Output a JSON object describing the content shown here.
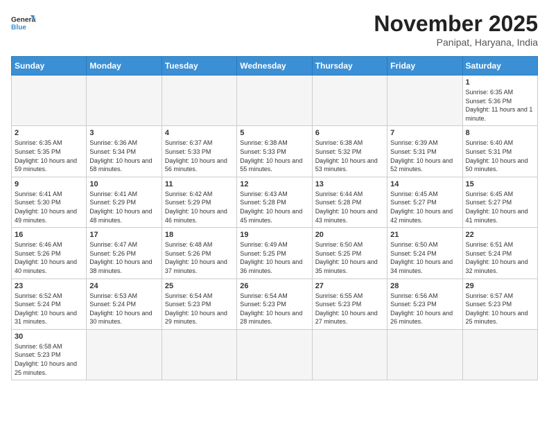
{
  "logo": {
    "line1": "General",
    "line2": "Blue"
  },
  "title": "November 2025",
  "location": "Panipat, Haryana, India",
  "days_of_week": [
    "Sunday",
    "Monday",
    "Tuesday",
    "Wednesday",
    "Thursday",
    "Friday",
    "Saturday"
  ],
  "weeks": [
    [
      {
        "day": null,
        "info": null
      },
      {
        "day": null,
        "info": null
      },
      {
        "day": null,
        "info": null
      },
      {
        "day": null,
        "info": null
      },
      {
        "day": null,
        "info": null
      },
      {
        "day": null,
        "info": null
      },
      {
        "day": "1",
        "info": "Sunrise: 6:35 AM\nSunset: 5:36 PM\nDaylight: 11 hours and 1 minute."
      }
    ],
    [
      {
        "day": "2",
        "info": "Sunrise: 6:35 AM\nSunset: 5:35 PM\nDaylight: 10 hours and 59 minutes."
      },
      {
        "day": "3",
        "info": "Sunrise: 6:36 AM\nSunset: 5:34 PM\nDaylight: 10 hours and 58 minutes."
      },
      {
        "day": "4",
        "info": "Sunrise: 6:37 AM\nSunset: 5:33 PM\nDaylight: 10 hours and 56 minutes."
      },
      {
        "day": "5",
        "info": "Sunrise: 6:38 AM\nSunset: 5:33 PM\nDaylight: 10 hours and 55 minutes."
      },
      {
        "day": "6",
        "info": "Sunrise: 6:38 AM\nSunset: 5:32 PM\nDaylight: 10 hours and 53 minutes."
      },
      {
        "day": "7",
        "info": "Sunrise: 6:39 AM\nSunset: 5:31 PM\nDaylight: 10 hours and 52 minutes."
      },
      {
        "day": "8",
        "info": "Sunrise: 6:40 AM\nSunset: 5:31 PM\nDaylight: 10 hours and 50 minutes."
      }
    ],
    [
      {
        "day": "9",
        "info": "Sunrise: 6:41 AM\nSunset: 5:30 PM\nDaylight: 10 hours and 49 minutes."
      },
      {
        "day": "10",
        "info": "Sunrise: 6:41 AM\nSunset: 5:29 PM\nDaylight: 10 hours and 48 minutes."
      },
      {
        "day": "11",
        "info": "Sunrise: 6:42 AM\nSunset: 5:29 PM\nDaylight: 10 hours and 46 minutes."
      },
      {
        "day": "12",
        "info": "Sunrise: 6:43 AM\nSunset: 5:28 PM\nDaylight: 10 hours and 45 minutes."
      },
      {
        "day": "13",
        "info": "Sunrise: 6:44 AM\nSunset: 5:28 PM\nDaylight: 10 hours and 43 minutes."
      },
      {
        "day": "14",
        "info": "Sunrise: 6:45 AM\nSunset: 5:27 PM\nDaylight: 10 hours and 42 minutes."
      },
      {
        "day": "15",
        "info": "Sunrise: 6:45 AM\nSunset: 5:27 PM\nDaylight: 10 hours and 41 minutes."
      }
    ],
    [
      {
        "day": "16",
        "info": "Sunrise: 6:46 AM\nSunset: 5:26 PM\nDaylight: 10 hours and 40 minutes."
      },
      {
        "day": "17",
        "info": "Sunrise: 6:47 AM\nSunset: 5:26 PM\nDaylight: 10 hours and 38 minutes."
      },
      {
        "day": "18",
        "info": "Sunrise: 6:48 AM\nSunset: 5:26 PM\nDaylight: 10 hours and 37 minutes."
      },
      {
        "day": "19",
        "info": "Sunrise: 6:49 AM\nSunset: 5:25 PM\nDaylight: 10 hours and 36 minutes."
      },
      {
        "day": "20",
        "info": "Sunrise: 6:50 AM\nSunset: 5:25 PM\nDaylight: 10 hours and 35 minutes."
      },
      {
        "day": "21",
        "info": "Sunrise: 6:50 AM\nSunset: 5:24 PM\nDaylight: 10 hours and 34 minutes."
      },
      {
        "day": "22",
        "info": "Sunrise: 6:51 AM\nSunset: 5:24 PM\nDaylight: 10 hours and 32 minutes."
      }
    ],
    [
      {
        "day": "23",
        "info": "Sunrise: 6:52 AM\nSunset: 5:24 PM\nDaylight: 10 hours and 31 minutes."
      },
      {
        "day": "24",
        "info": "Sunrise: 6:53 AM\nSunset: 5:24 PM\nDaylight: 10 hours and 30 minutes."
      },
      {
        "day": "25",
        "info": "Sunrise: 6:54 AM\nSunset: 5:23 PM\nDaylight: 10 hours and 29 minutes."
      },
      {
        "day": "26",
        "info": "Sunrise: 6:54 AM\nSunset: 5:23 PM\nDaylight: 10 hours and 28 minutes."
      },
      {
        "day": "27",
        "info": "Sunrise: 6:55 AM\nSunset: 5:23 PM\nDaylight: 10 hours and 27 minutes."
      },
      {
        "day": "28",
        "info": "Sunrise: 6:56 AM\nSunset: 5:23 PM\nDaylight: 10 hours and 26 minutes."
      },
      {
        "day": "29",
        "info": "Sunrise: 6:57 AM\nSunset: 5:23 PM\nDaylight: 10 hours and 25 minutes."
      }
    ],
    [
      {
        "day": "30",
        "info": "Sunrise: 6:58 AM\nSunset: 5:23 PM\nDaylight: 10 hours and 25 minutes."
      },
      {
        "day": null,
        "info": null
      },
      {
        "day": null,
        "info": null
      },
      {
        "day": null,
        "info": null
      },
      {
        "day": null,
        "info": null
      },
      {
        "day": null,
        "info": null
      },
      {
        "day": null,
        "info": null
      }
    ]
  ]
}
